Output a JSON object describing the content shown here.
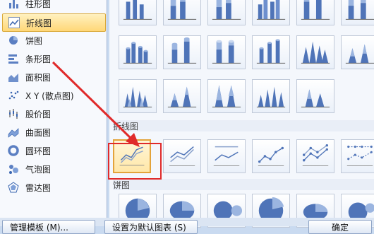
{
  "sidebar": {
    "items": [
      {
        "label": "柱形图",
        "icon": "column-chart-icon",
        "selected": false
      },
      {
        "label": "折线图",
        "icon": "line-chart-icon",
        "selected": true
      },
      {
        "label": "饼图",
        "icon": "pie-chart-icon",
        "selected": false
      },
      {
        "label": "条形图",
        "icon": "bar-chart-icon",
        "selected": false
      },
      {
        "label": "面积图",
        "icon": "area-chart-icon",
        "selected": false
      },
      {
        "label": "X Y (散点图)",
        "icon": "scatter-chart-icon",
        "selected": false
      },
      {
        "label": "股价图",
        "icon": "stock-chart-icon",
        "selected": false
      },
      {
        "label": "曲面图",
        "icon": "surface-chart-icon",
        "selected": false
      },
      {
        "label": "圆环图",
        "icon": "doughnut-chart-icon",
        "selected": false
      },
      {
        "label": "气泡图",
        "icon": "bubble-chart-icon",
        "selected": false
      },
      {
        "label": "雷达图",
        "icon": "radar-chart-icon",
        "selected": false
      }
    ]
  },
  "gallery": {
    "section_line": "折线图",
    "section_pie": "饼图"
  },
  "footer": {
    "manage_templates": "管理模板 (M)...",
    "set_default": "设置为默认图表 (S)",
    "ok": "确定"
  },
  "colors": {
    "accent": "#e02a2a",
    "selection": "#ffd777",
    "chart_blue": "#4f74b8"
  }
}
